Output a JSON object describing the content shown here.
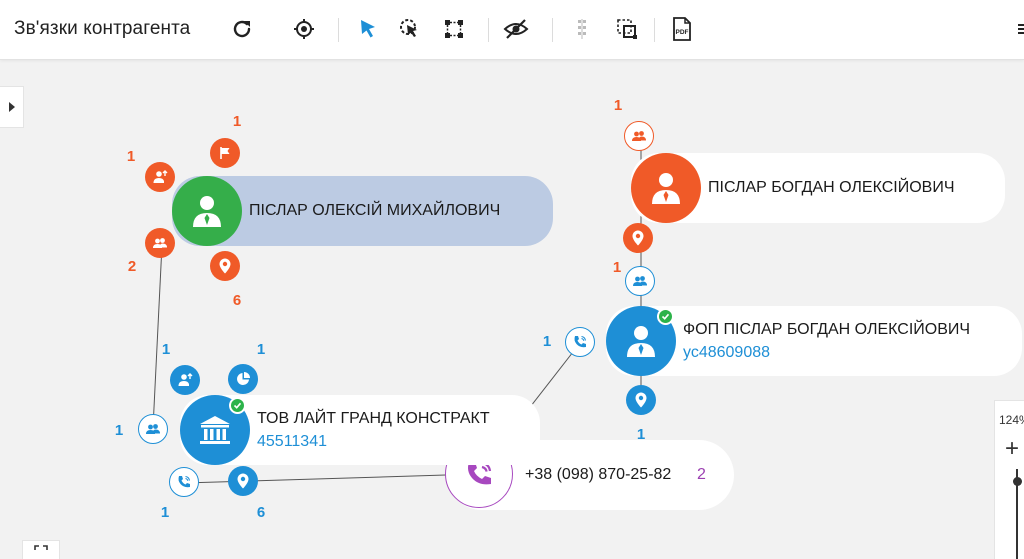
{
  "app": {
    "title": "Зв'язки контрагента"
  },
  "toolbar": {
    "icons": [
      "refresh-icon",
      "target-icon",
      "pointer-icon",
      "pointer-select-icon",
      "frame-select-icon",
      "eye-off-icon",
      "vertical-dots-icon",
      "group-select-icon",
      "pdf-icon"
    ],
    "pdf_label": "PDF"
  },
  "colors": {
    "orange": "#f05a28",
    "blue": "#1e8fd6",
    "green": "#35ae4a",
    "purple": "#a748bf",
    "pill_selected": "#bccbe3",
    "check_green": "#2cb34a"
  },
  "zoom": {
    "value": "124%",
    "plus": "+",
    "minus": "−"
  },
  "entities": {
    "oleksiy": {
      "name": "ПІСЛАР ОЛЕКСІЙ МИХАЙЛОВИЧ",
      "counts": {
        "flag": "1",
        "person_up": "1",
        "group": "2",
        "location": "6"
      }
    },
    "bohdan": {
      "name": "ПІСЛАР БОГДАН ОЛЕКСІЙОВИЧ",
      "counts": {
        "group_top": "1",
        "group_bottom": "1"
      }
    },
    "fop": {
      "name": "ФОП ПІСЛАР БОГДАН ОЛЕКСІЙОВИЧ",
      "code": "ус48609088",
      "counts": {
        "phone": "1",
        "location": "1"
      }
    },
    "company": {
      "name": "ТОВ ЛАЙТ ГРАНД КОНСТРАКТ",
      "code": "45511341",
      "counts": {
        "person_up": "1",
        "pie": "1",
        "group": "1",
        "phone": "1",
        "location": "6"
      }
    },
    "phone": {
      "number": "+38 (098) 870-25-82",
      "count": "2"
    }
  }
}
